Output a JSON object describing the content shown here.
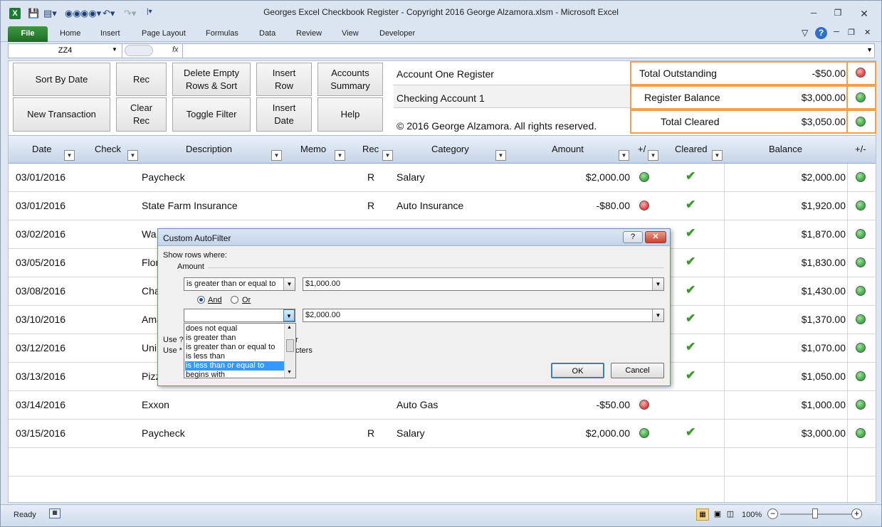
{
  "window": {
    "title": "Georges Excel Checkbook Register - Copyright 2016 George Alzamora.xlsm  -  Microsoft Excel"
  },
  "ribbon": {
    "tabs": [
      "File",
      "Home",
      "Insert",
      "Page Layout",
      "Formulas",
      "Data",
      "Review",
      "View",
      "Developer"
    ]
  },
  "formula_bar": {
    "name_box": "ZZ4",
    "fx": "fx",
    "value": ""
  },
  "buttons": {
    "sort_by_date": "Sort By Date",
    "rec": "Rec",
    "delete_empty": "Delete Empty Rows & Sort",
    "insert_row": "Insert Row",
    "accounts_summary": "Accounts Summary",
    "new_transaction": "New Transaction",
    "clear_rec": "Clear Rec",
    "toggle_filter": "Toggle Filter",
    "insert_date": "Insert Date",
    "help": "Help"
  },
  "account": {
    "register_name": "Account One Register",
    "account_name": "Checking Account 1",
    "copyright": "© 2016 George Alzamora.  All rights reserved."
  },
  "summary": [
    {
      "label": "Total Outstanding",
      "value": "-$50.00",
      "status": "red"
    },
    {
      "label": "Register Balance",
      "value": "$3,000.00",
      "status": "green"
    },
    {
      "label": "Total Cleared",
      "value": "$3,050.00",
      "status": "green"
    }
  ],
  "columns": {
    "date": "Date",
    "check": "Check",
    "description": "Description",
    "memo": "Memo",
    "rec": "Rec",
    "category": "Category",
    "amount": "Amount",
    "plusminus": "+/",
    "cleared": "Cleared",
    "balance": "Balance",
    "plusminus2": "+/-"
  },
  "rows": [
    {
      "date": "03/01/2016",
      "description": "Paycheck",
      "rec": "R",
      "category": "Salary",
      "amount": "$2,000.00",
      "amount_status": "green",
      "cleared": true,
      "balance": "$2,000.00"
    },
    {
      "date": "03/01/2016",
      "description": "State Farm Insurance",
      "rec": "R",
      "category": "Auto Insurance",
      "amount": "-$80.00",
      "amount_status": "red",
      "cleared": true,
      "balance": "$1,920.00"
    },
    {
      "date": "03/02/2016",
      "description": "Wa",
      "rec": "",
      "category": "",
      "amount": "",
      "amount_status": "",
      "cleared": true,
      "balance": "$1,870.00"
    },
    {
      "date": "03/05/2016",
      "description": "Flor",
      "rec": "",
      "category": "",
      "amount": "",
      "amount_status": "",
      "cleared": true,
      "balance": "$1,830.00"
    },
    {
      "date": "03/08/2016",
      "description": "Cha",
      "rec": "",
      "category": "",
      "amount": "",
      "amount_status": "",
      "cleared": true,
      "balance": "$1,430.00"
    },
    {
      "date": "03/10/2016",
      "description": "Ama",
      "rec": "",
      "category": "",
      "amount": "",
      "amount_status": "",
      "cleared": true,
      "balance": "$1,370.00"
    },
    {
      "date": "03/12/2016",
      "description": "Uni",
      "rec": "",
      "category": "",
      "amount": "",
      "amount_status": "",
      "cleared": true,
      "balance": "$1,070.00"
    },
    {
      "date": "03/13/2016",
      "description": "Pizz",
      "rec": "",
      "category": "",
      "amount": "",
      "amount_status": "",
      "cleared": true,
      "balance": "$1,050.00"
    },
    {
      "date": "03/14/2016",
      "description": "Exxon",
      "rec": "",
      "category": "Auto Gas",
      "amount": "-$50.00",
      "amount_status": "red",
      "cleared": false,
      "balance": "$1,000.00"
    },
    {
      "date": "03/15/2016",
      "description": "Paycheck",
      "rec": "R",
      "category": "Salary",
      "amount": "$2,000.00",
      "amount_status": "green",
      "cleared": true,
      "balance": "$3,000.00"
    }
  ],
  "dialog": {
    "title": "Custom AutoFilter",
    "help_label": "?",
    "show_rows": "Show rows where:",
    "field": "Amount",
    "op1": "is greater than or equal to",
    "val1": "$1,000.00",
    "and_label": "And",
    "or_label": "Or",
    "op2": "",
    "val2": "$2,000.00",
    "hint1_partial": "Use ?",
    "hint1_tail": "r",
    "hint2_partial": "Use *",
    "hint2_tail": "cters",
    "ok": "OK",
    "cancel": "Cancel",
    "options": [
      "does not equal",
      "is greater than",
      "is greater than or equal to",
      "is less than",
      "is less than or equal to",
      "begins with"
    ],
    "highlighted_option": "is less than or equal to"
  },
  "status_bar": {
    "ready": "Ready",
    "zoom": "100%"
  }
}
